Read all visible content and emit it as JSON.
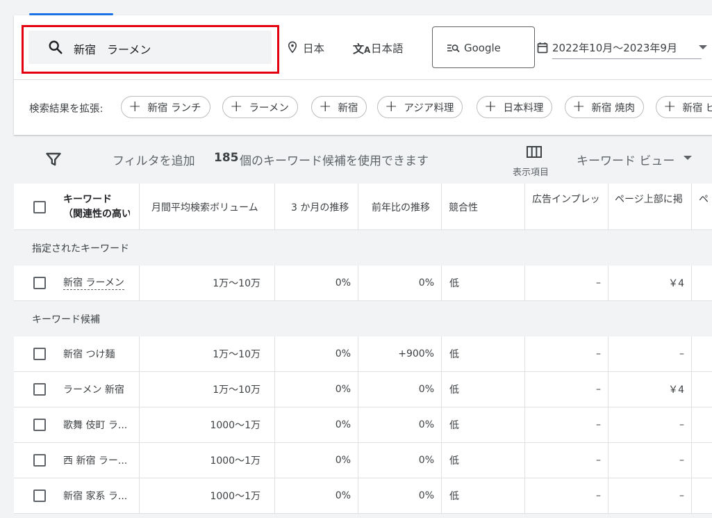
{
  "search": {
    "query": "新宿　ラーメン"
  },
  "location": {
    "label": "日本"
  },
  "language": {
    "label": "日本語"
  },
  "network": {
    "label": "Google"
  },
  "date_range": {
    "label": "2022年10月～2023年9月"
  },
  "expand": {
    "label": "検索結果を拡張:",
    "chips": [
      "新宿 ランチ",
      "ラーメン",
      "新宿",
      "アジア料理",
      "日本料理",
      "新宿 焼肉",
      "新宿 ビ"
    ]
  },
  "toolbar": {
    "add_filter": "フィルタを追加",
    "count_prefix": "185",
    "count_suffix": "個のキーワード候補を使用できます",
    "columns_label": "表示項目",
    "view_label": "キーワード ビュー"
  },
  "table": {
    "headers": {
      "keyword_line1": "キーワード",
      "keyword_line2": "（関連性の高い",
      "volume": "月間平均検索ボリューム",
      "three_month": "3 か月の推移",
      "yoy": "前年比の推移",
      "competition": "競合性",
      "impression": "広告インプレッ",
      "top_page": "ページ上部に掲",
      "extra": "ペ"
    },
    "section_specified": "指定されたキーワード",
    "section_candidates": "キーワード候補",
    "specified_rows": [
      {
        "keyword": "新宿 ラーメン",
        "volume": "1万～10万",
        "three_month": "0%",
        "yoy": "0%",
        "competition": "低",
        "impression": "–",
        "top_page": "￥4"
      }
    ],
    "candidate_rows": [
      {
        "keyword": "新宿 つけ麺",
        "volume": "1万～10万",
        "three_month": "0%",
        "yoy": "+900%",
        "competition": "低",
        "impression": "–",
        "top_page": "–"
      },
      {
        "keyword": "ラーメン 新宿",
        "volume": "1万～10万",
        "three_month": "0%",
        "yoy": "0%",
        "competition": "低",
        "impression": "–",
        "top_page": "￥4"
      },
      {
        "keyword": "歌舞 伎町 ラ...",
        "volume": "1000～1万",
        "three_month": "0%",
        "yoy": "0%",
        "competition": "低",
        "impression": "–",
        "top_page": "–"
      },
      {
        "keyword": "西 新宿 ラー...",
        "volume": "1000～1万",
        "three_month": "0%",
        "yoy": "0%",
        "competition": "低",
        "impression": "–",
        "top_page": "–"
      },
      {
        "keyword": "新宿 家系 ラ...",
        "volume": "1000～1万",
        "three_month": "0%",
        "yoy": "0%",
        "competition": "低",
        "impression": "–",
        "top_page": "–"
      }
    ]
  },
  "colors": {
    "accent": "#1a73e8",
    "highlight": "#e4000f"
  }
}
